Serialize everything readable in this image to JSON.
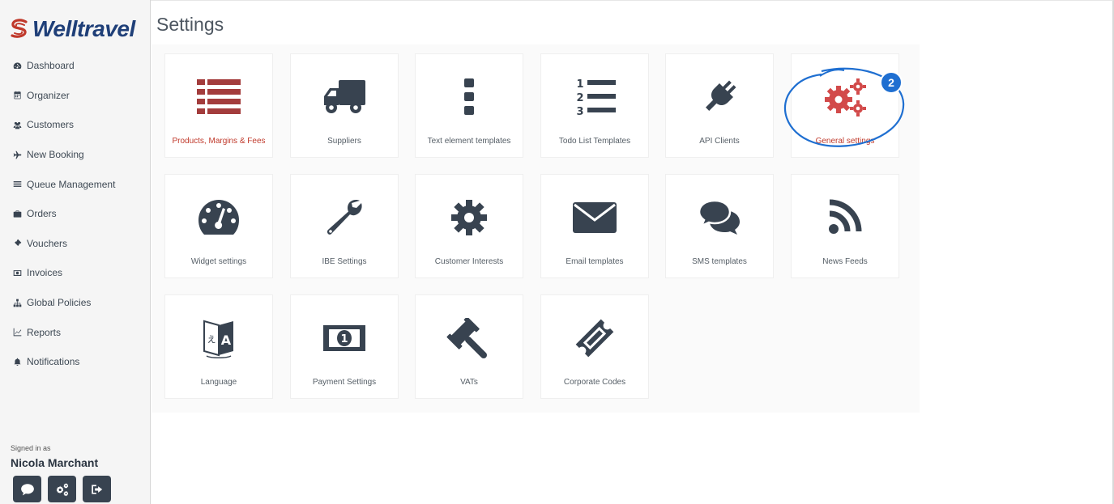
{
  "brand": {
    "name": "Welltravel",
    "accent": "#1f3f78",
    "mark_color": "#c0392b"
  },
  "page": {
    "title": "Settings"
  },
  "sidebar": {
    "items": [
      {
        "label": "Dashboard",
        "icon": "dashboard-icon"
      },
      {
        "label": "Organizer",
        "icon": "calendar-icon"
      },
      {
        "label": "Customers",
        "icon": "users-icon"
      },
      {
        "label": "New Booking",
        "icon": "plane-icon"
      },
      {
        "label": "Queue Management",
        "icon": "list-icon"
      },
      {
        "label": "Orders",
        "icon": "briefcase-icon"
      },
      {
        "label": "Vouchers",
        "icon": "ticket-icon"
      },
      {
        "label": "Invoices",
        "icon": "money-icon"
      },
      {
        "label": "Global Policies",
        "icon": "sitemap-icon"
      },
      {
        "label": "Reports",
        "icon": "chart-icon"
      },
      {
        "label": "Notifications",
        "icon": "bell-icon"
      }
    ],
    "signed_in_label": "Signed in as",
    "user_name": "Nicola Marchant",
    "buttons": [
      {
        "icon": "chat-icon"
      },
      {
        "icon": "cogs-icon"
      },
      {
        "icon": "sign-out-icon"
      }
    ]
  },
  "tiles": [
    {
      "label": "Products, Margins & Fees",
      "icon": "list-icon",
      "color": "#a33c3c",
      "highlight": true
    },
    {
      "label": "Suppliers",
      "icon": "truck-icon",
      "color": "#384350"
    },
    {
      "label": "Text element templates",
      "icon": "ellipsis-vertical-icon",
      "color": "#384350"
    },
    {
      "label": "Todo List Templates",
      "icon": "ordered-list-icon",
      "color": "#384350"
    },
    {
      "label": "API Clients",
      "icon": "plug-icon",
      "color": "#384350"
    },
    {
      "label": "General settings",
      "icon": "cogs-icon",
      "color": "#d24a4a",
      "highlight": true
    },
    {
      "label": "Widget settings",
      "icon": "gauge-icon",
      "color": "#384350"
    },
    {
      "label": "IBE Settings",
      "icon": "wrench-icon",
      "color": "#384350"
    },
    {
      "label": "Customer Interests",
      "icon": "gear-icon",
      "color": "#384350"
    },
    {
      "label": "Email templates",
      "icon": "envelope-icon",
      "color": "#384350"
    },
    {
      "label": "SMS templates",
      "icon": "comments-icon",
      "color": "#384350"
    },
    {
      "label": "News Feeds",
      "icon": "rss-icon",
      "color": "#384350"
    },
    {
      "label": "Language",
      "icon": "language-icon",
      "color": "#384350"
    },
    {
      "label": "Payment Settings",
      "icon": "money-bill-icon",
      "color": "#384350"
    },
    {
      "label": "VATs",
      "icon": "gavel-icon",
      "color": "#384350"
    },
    {
      "label": "Corporate Codes",
      "icon": "ticket-icon",
      "color": "#384350"
    }
  ],
  "annotation": {
    "badge": "2",
    "color": "#1f6fd1"
  }
}
